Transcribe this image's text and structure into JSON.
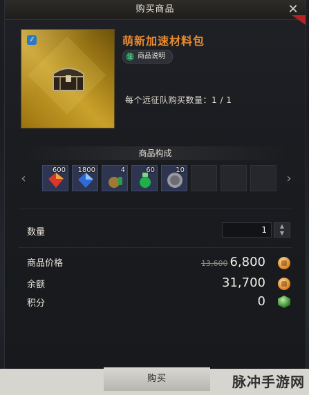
{
  "header": {
    "title": "购买商品",
    "close_label": "✕"
  },
  "item": {
    "name": "萌新加速材料包",
    "tag": "⁄⁄",
    "desc_badge": "注",
    "desc_label": "商品说明",
    "purchase_limit": "每个远征队购买数量：1 / 1"
  },
  "composition": {
    "title": "商品构成",
    "slots": [
      {
        "qty": "600",
        "icon": "red-gem-icon"
      },
      {
        "qty": "1800",
        "icon": "blue-crystal-icon"
      },
      {
        "qty": "4",
        "icon": "pouch-icon"
      },
      {
        "qty": "60",
        "icon": "green-potion-icon"
      },
      {
        "qty": "10",
        "icon": "silver-coin-icon"
      },
      {
        "qty": "",
        "icon": ""
      },
      {
        "qty": "",
        "icon": ""
      },
      {
        "qty": "",
        "icon": ""
      }
    ]
  },
  "quantity": {
    "label": "数量",
    "value": "1"
  },
  "price": {
    "label": "商品价格",
    "original": "13,600",
    "current": "6,800"
  },
  "balance": {
    "label": "余额",
    "value": "31,700"
  },
  "points": {
    "label": "积分",
    "value": "0"
  },
  "buy_button": "购买",
  "watermark": "脉冲手游网",
  "colors": {
    "item_name": "#e98a2e",
    "background": "#15171b"
  }
}
